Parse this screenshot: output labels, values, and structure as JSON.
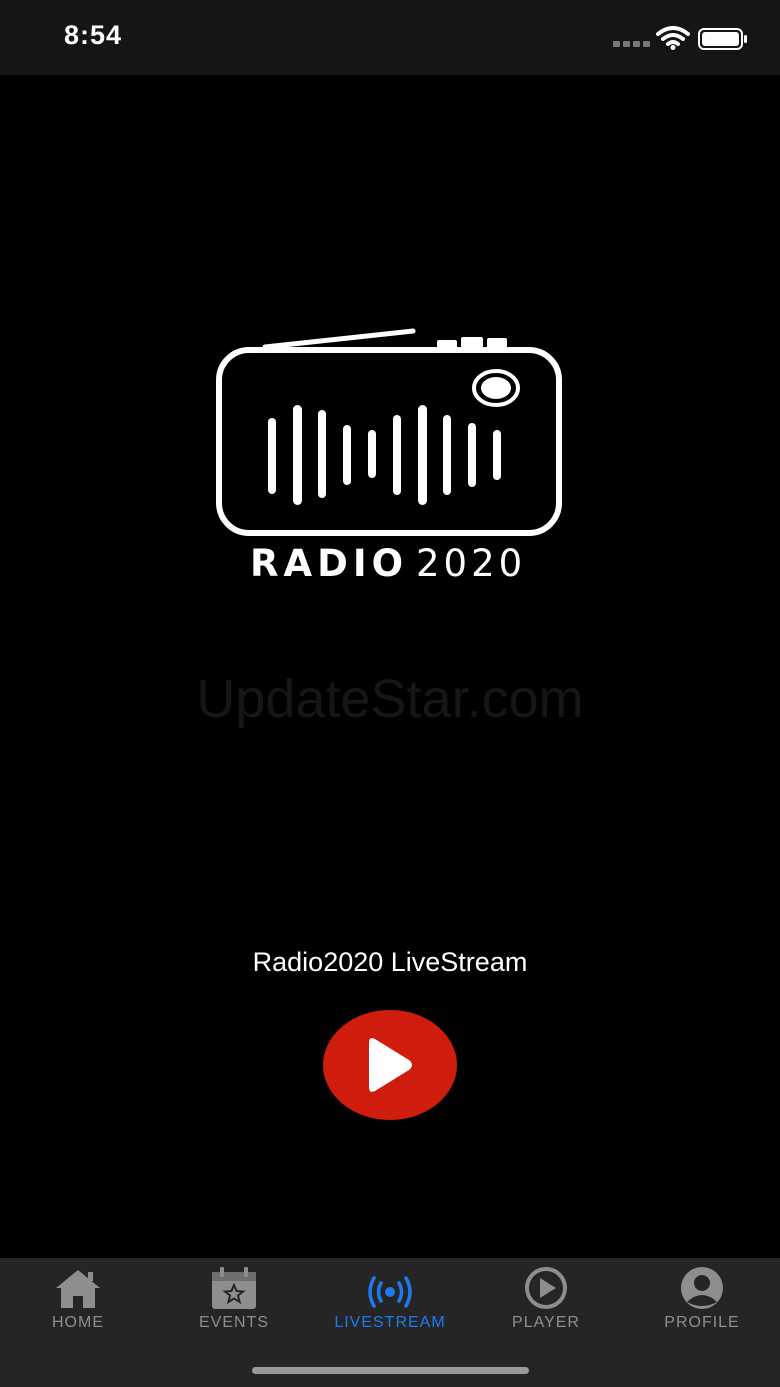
{
  "status_bar": {
    "time": "8:54",
    "signal_icon": "cellular-signal-icon",
    "wifi_icon": "wifi-icon",
    "battery_icon": "battery-icon"
  },
  "logo": {
    "icon": "radio-logo-icon",
    "text_bold": "RADIO",
    "text_light": "2020"
  },
  "watermark": "UpdateStar.com",
  "stream": {
    "title": "Radio2020 LiveStream",
    "play_icon": "play-icon",
    "play_color": "#d01c0c"
  },
  "tabs": [
    {
      "label": "HOME",
      "icon": "home-icon",
      "active": false
    },
    {
      "label": "EVENTS",
      "icon": "calendar-star-icon",
      "active": false
    },
    {
      "label": "LIVESTREAM",
      "icon": "broadcast-icon",
      "active": true
    },
    {
      "label": "PLAYER",
      "icon": "play-circle-icon",
      "active": false
    },
    {
      "label": "PROFILE",
      "icon": "user-circle-icon",
      "active": false
    }
  ],
  "colors": {
    "background": "#000000",
    "tab_bar": "#252525",
    "tab_active": "#1e7af0",
    "tab_inactive": "#8e8e8e"
  }
}
